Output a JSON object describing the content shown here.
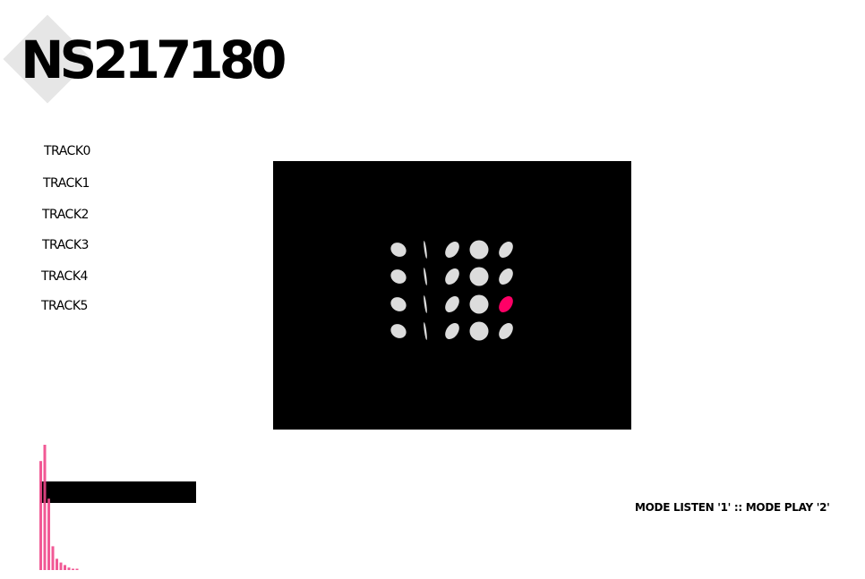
{
  "app": {
    "title": "NS217180"
  },
  "tracks": [
    {
      "label": "TRACK0"
    },
    {
      "label": "TRACK1"
    },
    {
      "label": "TRACK2"
    },
    {
      "label": "TRACK3"
    },
    {
      "label": "TRACK4"
    },
    {
      "label": "TRACK5"
    }
  ],
  "grid": {
    "rows": 4,
    "columns": [
      "tilted-ellipse",
      "thin-line",
      "tilted-ellipse",
      "circle",
      "tilted-ellipse"
    ],
    "active_cell": {
      "row": 2,
      "column": 4
    },
    "colors": {
      "background": "#000000",
      "note": "#dcdcdc",
      "active": "#ff0066"
    }
  },
  "level_meter": {
    "bars": [
      0.87,
      1.0,
      0.57,
      0.19,
      0.09,
      0.06,
      0.04,
      0.02,
      0.01,
      0.01
    ],
    "color": "#f0478a"
  },
  "footer": {
    "mode_text": "MODE LISTEN '1' :: MODE PLAY '2'"
  }
}
